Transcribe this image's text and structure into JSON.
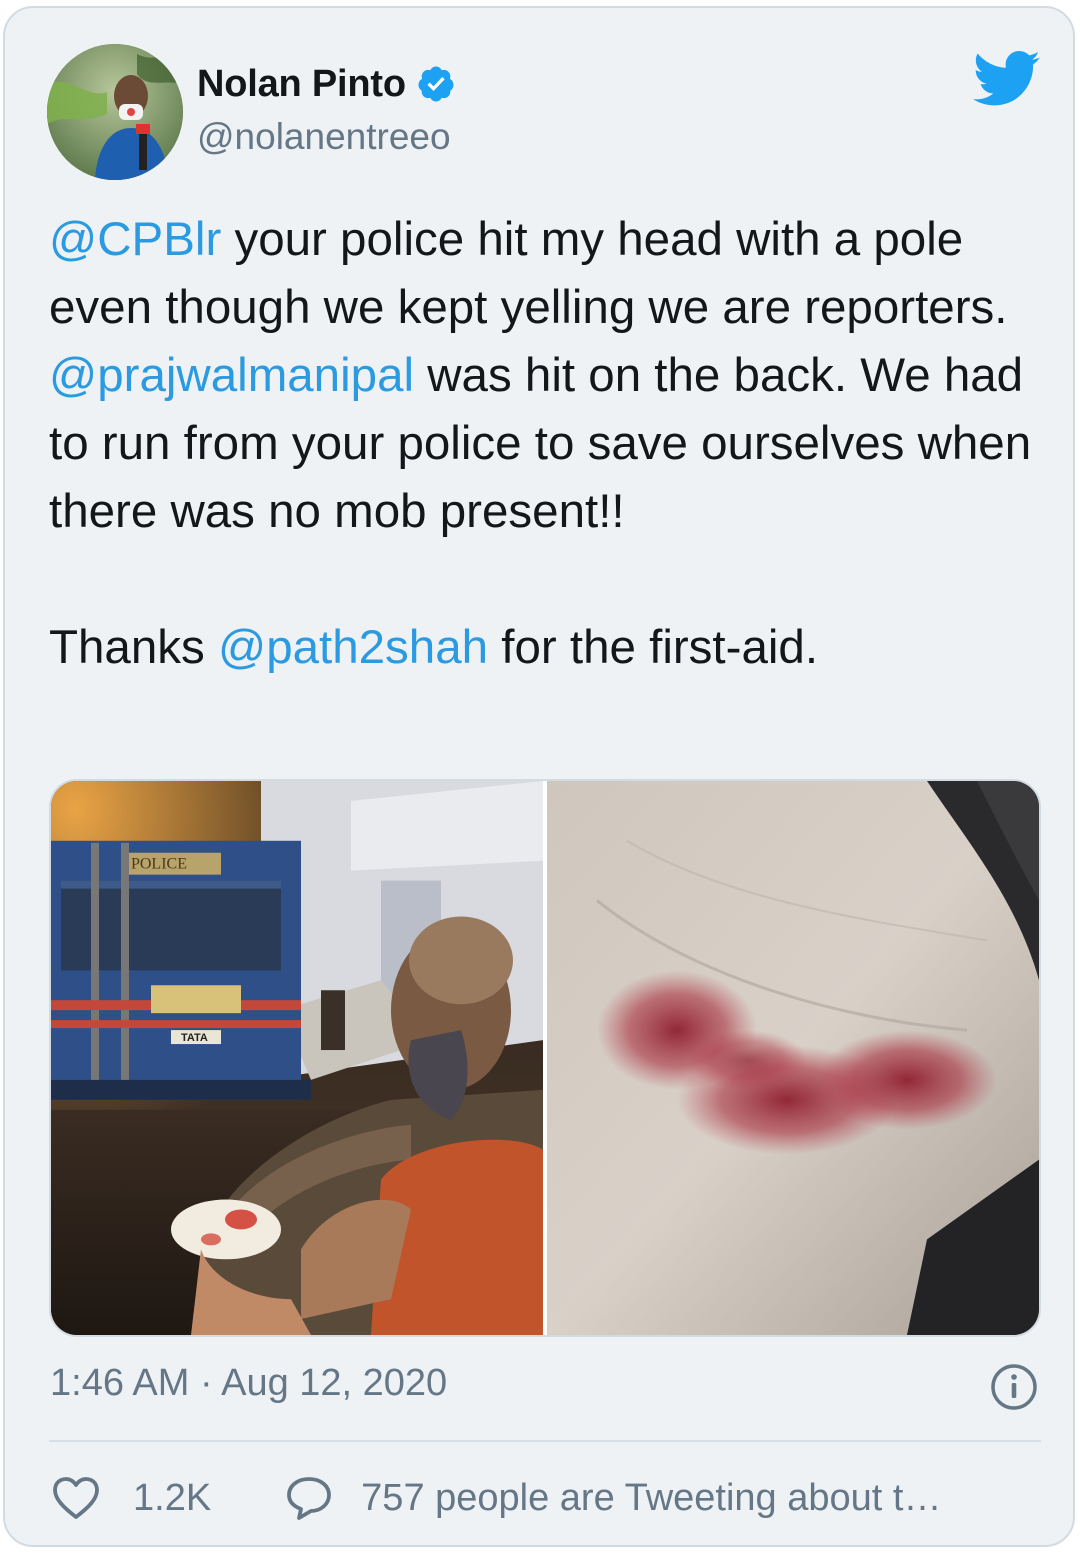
{
  "author": {
    "name": "Nolan Pinto",
    "handle": "@nolanentreeo",
    "verified": true,
    "verified_icon": "verified-badge-icon",
    "avatar_icon": "avatar-photo"
  },
  "brand": {
    "icon": "twitter-bird-icon",
    "color": "#1da1f2"
  },
  "tweet": {
    "segments": [
      {
        "type": "mention",
        "text": "@CPBlr"
      },
      {
        "type": "text",
        "text": " your police hit my head with a pole even though we kept yelling we are reporters. "
      },
      {
        "type": "mention",
        "text": "@prajwalmanipal"
      },
      {
        "type": "text",
        "text": " was hit on the back. We had to run from your police to save ourselves when there was no mob present!!\n\nThanks "
      },
      {
        "type": "mention",
        "text": "@path2shah"
      },
      {
        "type": "text",
        "text": " for the first-aid."
      }
    ]
  },
  "media": {
    "images": [
      {
        "name": "photo-injured-reporter-by-police-van",
        "bus_label": "POLICE",
        "plate_label": "TATA"
      },
      {
        "name": "photo-bruised-back"
      }
    ]
  },
  "meta": {
    "timestamp": "1:46 AM · Aug 12, 2020",
    "info_icon": "info-icon"
  },
  "actions": {
    "like_icon": "heart-icon",
    "like_count": "1.2K",
    "reply_icon": "speech-bubble-icon",
    "discussion_text": "757 people are Tweeting about t…"
  },
  "colors": {
    "mention": "#2b9ae0",
    "text": "#14171a",
    "secondary": "#657786",
    "background": "#eef2f5",
    "border": "#d3dbe2"
  }
}
